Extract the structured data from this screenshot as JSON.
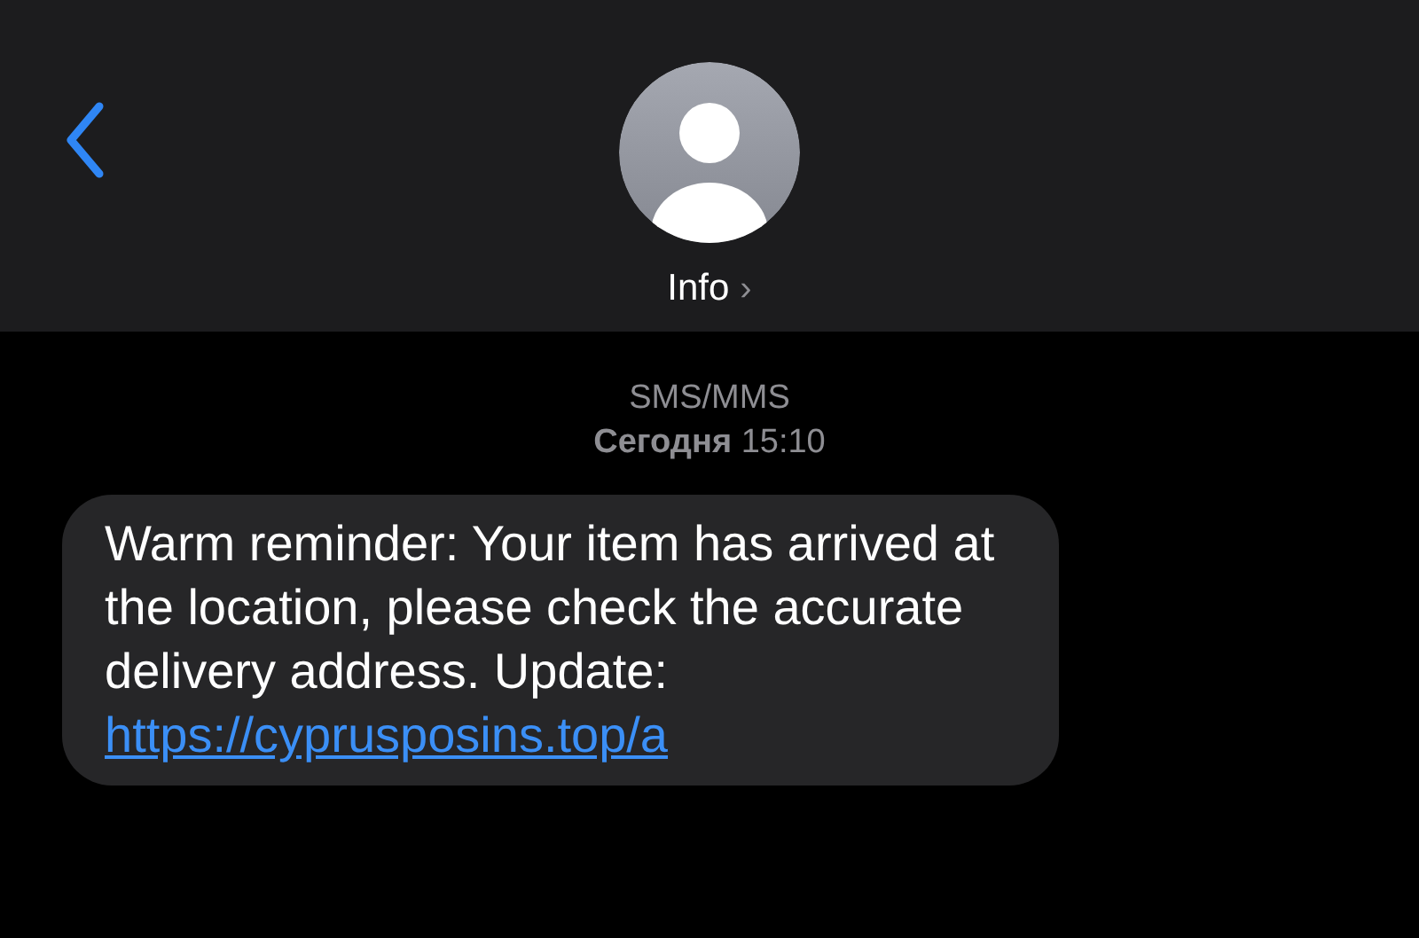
{
  "header": {
    "contact": "Info",
    "chevron": "›"
  },
  "thread": {
    "service": "SMS/MMS",
    "timestamp": "**Сегодня** 15:10"
  },
  "messages": [
    {
      "text": "Warm reminder: Your item has arrived at the location, please check the accurate delivery address. Update:",
      "link": "https://cyprusposins.top/a"
    }
  ]
}
